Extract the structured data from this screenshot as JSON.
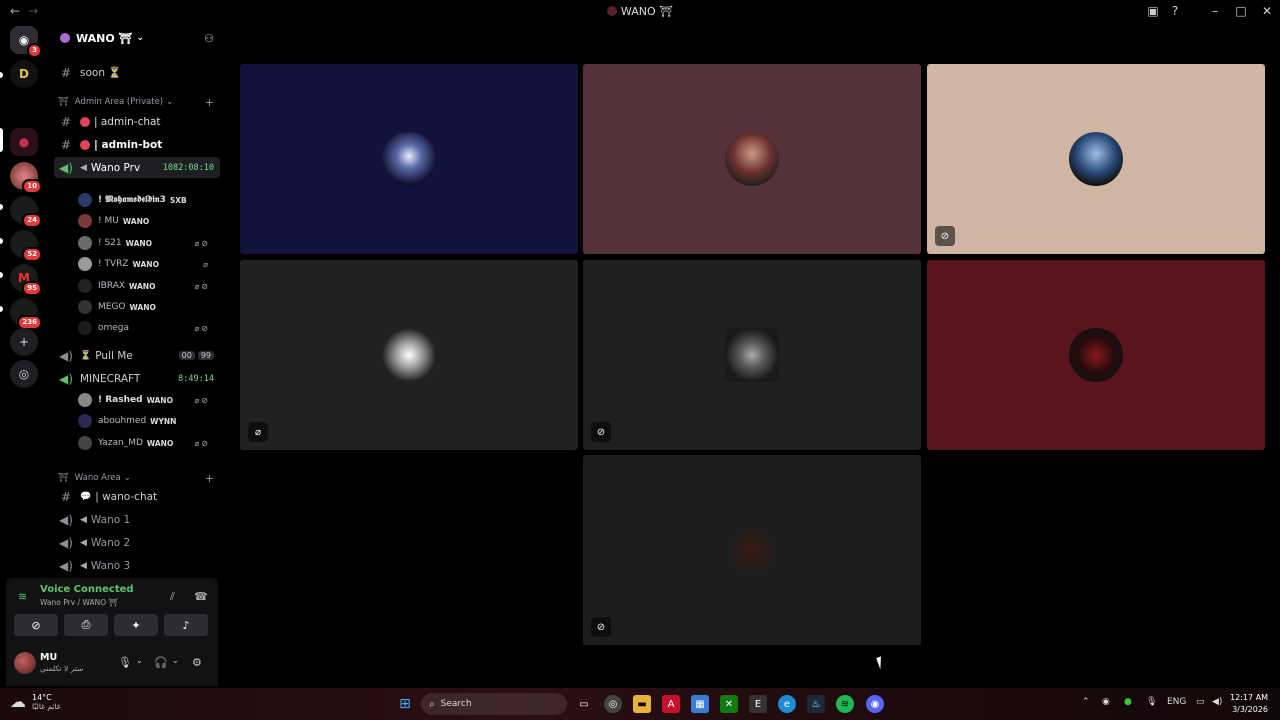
{
  "window": {
    "title": "WANO ⛩"
  },
  "server": {
    "name": "WANO ⛩"
  },
  "rail_badges": [
    "3",
    "10",
    "24",
    "52",
    "95",
    "236"
  ],
  "channels": {
    "soon": "soon ⏳",
    "cat_admin": "Admin Area (Private)",
    "admin_chat": "| admin-chat",
    "admin_bot": "| admin-bot",
    "wano_prv": "Wano Prv",
    "wano_prv_timer": "1082:08:10",
    "pull_me": "Pull Me",
    "pull_me_count_a": "00",
    "pull_me_count_b": "99",
    "minecraft": "MINECRAFT",
    "minecraft_timer": "8:49:14",
    "cat_wano": "Wano Area",
    "wano_chat": "| wano-chat",
    "wano1": "Wano 1",
    "wano2": "Wano 2",
    "wano3": "Wano 3"
  },
  "prv_users": [
    {
      "name": "! 𝕸𝖔𝖍𝖆𝖒𝖊𝖉𝖊𝖑𝖉𝖎𝖓3",
      "tag": "SXB"
    },
    {
      "name": "! MU",
      "tag": "WANO"
    },
    {
      "name": "! S21",
      "tag": "WANO"
    },
    {
      "name": "! TVRZ",
      "tag": "WANO"
    },
    {
      "name": "IBRAX",
      "tag": "WANO"
    },
    {
      "name": "MEGO",
      "tag": "WANO"
    },
    {
      "name": "omega",
      "tag": ""
    }
  ],
  "mc_users": [
    {
      "name": "! Rashed",
      "tag": "WANO"
    },
    {
      "name": "abouhmed",
      "tag": "WYNN"
    },
    {
      "name": "Yazan_MD",
      "tag": "WANO"
    }
  ],
  "voice": {
    "status": "Voice Connected",
    "location": "Wano Prv / WANO ⛩"
  },
  "me": {
    "name": "MU",
    "status": "ستر لا تكلمني"
  },
  "taskbar": {
    "temp": "14°C",
    "weather": "غائم غالبًا",
    "search": "Search",
    "lang": "ENG",
    "time": "12:17 AM",
    "date": "3/3/2026"
  },
  "colors": {
    "tile1": "#12123f",
    "tile2": "#55323a",
    "tile3": "#cfb5a4",
    "tile4": "#212121",
    "tile5": "#1f1f1f",
    "tile6": "#5a141c",
    "tile7": "#1d1d1d",
    "voice_green": "#5fc46d"
  }
}
